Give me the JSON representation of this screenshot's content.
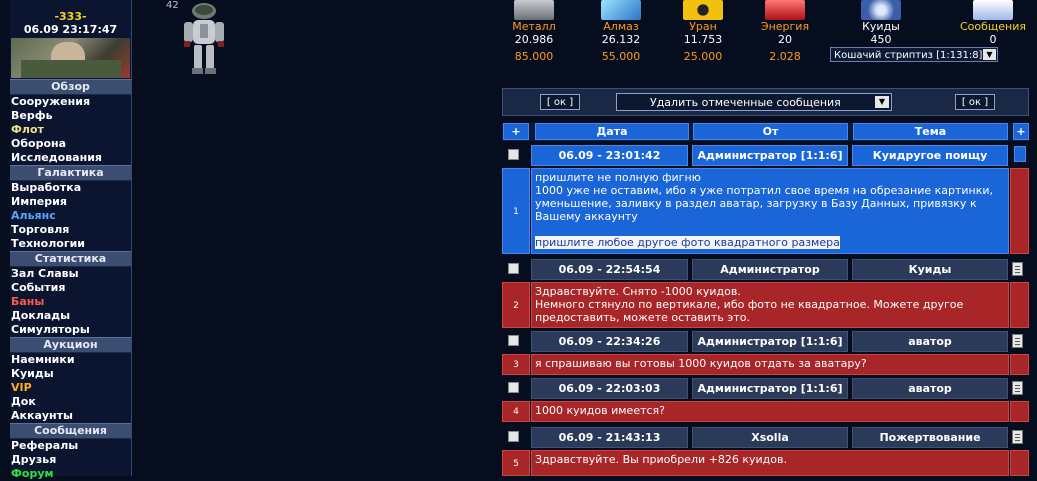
{
  "user": {
    "name": "-333-",
    "time": "06.09 23:17:47"
  },
  "robot_count": "42",
  "sidebar": [
    {
      "section": "Обзор",
      "items": [
        {
          "label": "Сооружения",
          "color": "white"
        },
        {
          "label": "Верфь",
          "color": "white"
        },
        {
          "label": "Флот",
          "color": "yellow"
        },
        {
          "label": "Оборона",
          "color": "white"
        },
        {
          "label": "Исследования",
          "color": "white"
        }
      ]
    },
    {
      "section": "Галактика",
      "items": [
        {
          "label": "Выработка",
          "color": "white"
        },
        {
          "label": "Империя",
          "color": "white"
        },
        {
          "label": "Альянс",
          "color": "blue"
        },
        {
          "label": "Торговля",
          "color": "white"
        },
        {
          "label": "Технологии",
          "color": "white"
        }
      ]
    },
    {
      "section": "Статистика",
      "items": [
        {
          "label": "Зал Славы",
          "color": "white"
        },
        {
          "label": "События",
          "color": "white"
        },
        {
          "label": "Баны",
          "color": "red"
        },
        {
          "label": "Доклады",
          "color": "white"
        },
        {
          "label": "Симуляторы",
          "color": "white"
        }
      ]
    },
    {
      "section": "Аукцион",
      "items": [
        {
          "label": "Наемники",
          "color": "white"
        },
        {
          "label": "Куиды",
          "color": "white"
        },
        {
          "label": "VIP",
          "color": "orange"
        },
        {
          "label": "Док",
          "color": "white"
        },
        {
          "label": "Аккаунты",
          "color": "white"
        }
      ]
    },
    {
      "section": "Сообщения",
      "items": [
        {
          "label": "Рефералы",
          "color": "white"
        },
        {
          "label": "Друзья",
          "color": "white"
        },
        {
          "label": "Форум",
          "color": "green"
        }
      ]
    }
  ],
  "resources": [
    {
      "name": "Металл",
      "value": "20.986",
      "prod": "85.000",
      "icon": "metal-icon",
      "name_color": "#ff9a1e"
    },
    {
      "name": "Алмаз",
      "value": "26.132",
      "prod": "55.000",
      "icon": "diamond-icon",
      "name_color": "#ff9a1e"
    },
    {
      "name": "Уран",
      "value": "11.753",
      "prod": "25.000",
      "icon": "radiation-icon",
      "name_color": "#ff9a1e"
    },
    {
      "name": "Энергия",
      "value": "20",
      "prod": "2.028",
      "icon": "energy-icon",
      "name_color": "#ff9a1e"
    },
    {
      "name": "Куиды",
      "value": "450",
      "prod": "",
      "icon": "quid-icon",
      "name_color": "#ffffff"
    },
    {
      "name": "Сообщения",
      "value": "0",
      "prod": "",
      "icon": "message-icon",
      "name_color": "#f5d21a"
    }
  ],
  "planet_select": "Кошачий стриптиз [1:131:8]",
  "actions": {
    "ok_left": "[ ок ]",
    "ok_right": "[ ок ]",
    "delete_option": "Удалить отмеченные сообщения"
  },
  "table_header": {
    "plus": "+",
    "date": "Дата",
    "from": "От",
    "subject": "Тема"
  },
  "messages": [
    {
      "num": "1",
      "date": "06.09 - 23:01:42",
      "from": "Администратор [1:1:6]",
      "subject": "Куидругое поищу",
      "selected": true,
      "text": [
        "пришлите не полную фигню",
        "1000 уже не оставим, ибо я уже потратил свое время на обрезание картинки, уменьшение, заливку в раздел аватар, загрузку в Базу Данных, привязку к Вашему аккаунту",
        "",
        "пришлите любое другое фото квадратного размера"
      ]
    },
    {
      "num": "2",
      "date": "06.09 - 22:54:54",
      "from": "Администратор",
      "subject": "Куиды",
      "selected": false,
      "text": [
        "Здравствуйте. Снято -1000 куидов.",
        "Немного стянуло по вертикале, ибо фото не квадратное. Можете другое предоставить, можете оставить это."
      ]
    },
    {
      "num": "3",
      "date": "06.09 - 22:34:26",
      "from": "Администратор [1:1:6]",
      "subject": "аватор",
      "selected": false,
      "text": [
        "я спрашиваю вы готовы 1000 куидов отдать за аватару?"
      ]
    },
    {
      "num": "4",
      "date": "06.09 - 22:03:03",
      "from": "Администратор [1:1:6]",
      "subject": "аватор",
      "selected": false,
      "text": [
        "1000 куидов имеется?"
      ]
    },
    {
      "num": "5",
      "date": "06.09 - 21:43:13",
      "from": "Xsolla",
      "subject": "Пожертвование",
      "selected": false,
      "text": [
        "Здравствуйте. Вы приобрели +826 куидов."
      ]
    }
  ]
}
